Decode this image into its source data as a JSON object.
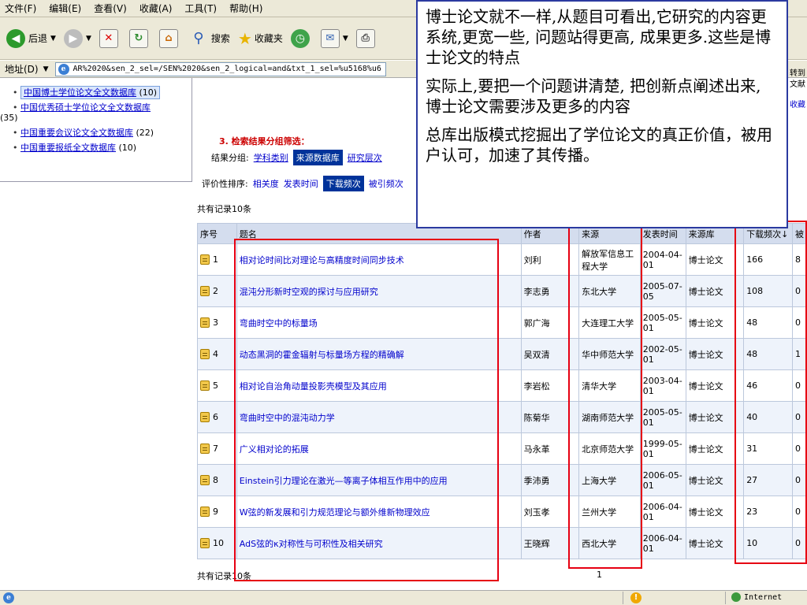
{
  "menu": [
    "文件(F)",
    "编辑(E)",
    "查看(V)",
    "收藏(A)",
    "工具(T)",
    "帮助(H)"
  ],
  "toolbar": {
    "back": "后退",
    "search": "搜索",
    "favorites": "收藏夹"
  },
  "address": {
    "label": "地址(D)",
    "url": "AR%2020&sen_2_sel=/SEN%2020&sen_2_logical=and&txt_1_sel=%u5168%u6"
  },
  "sidebar": {
    "items": [
      {
        "label": "中国博士学位论文全文数据库",
        "count": "(10)"
      },
      {
        "label": "中国优秀硕士学位论文全文数据库",
        "count": "(35)"
      },
      {
        "label": "中国重要会议论文全文数据库",
        "count": "(22)"
      },
      {
        "label": "中国重要报纸全文数据库",
        "count": "(10)"
      }
    ]
  },
  "filter": {
    "title": "3. 检索结果分组筛选：",
    "group_label": "结果分组:",
    "group_subject": "学科类别",
    "group_source": "来源数据库",
    "group_level": "研究层次",
    "sort_label": "评价性排序:",
    "sort_relevance": "相关度",
    "sort_date": "发表时间",
    "sort_downloads": "下载频次",
    "sort_cited": "被引频次"
  },
  "record_count": "共有记录10条",
  "page_number": "1",
  "table": {
    "headers": [
      "序号",
      "题名",
      "作者",
      "来源",
      "发表时间",
      "来源库",
      "下载频次↓",
      "被"
    ],
    "rows": [
      {
        "no": "1",
        "title": "相对论时间比对理论与高精度时间同步技术",
        "author": "刘利",
        "source": "解放军信息工程大学",
        "date": "2004-04-01",
        "db": "博士论文",
        "downloads": "166",
        "cited": "8"
      },
      {
        "no": "2",
        "title": "混沌分形新时空观的探讨与应用研究",
        "author": "李志勇",
        "source": "东北大学",
        "date": "2005-07-05",
        "db": "博士论文",
        "downloads": "108",
        "cited": "0"
      },
      {
        "no": "3",
        "title": "弯曲时空中的标量场",
        "author": "郭广海",
        "source": "大连理工大学",
        "date": "2005-05-01",
        "db": "博士论文",
        "downloads": "48",
        "cited": "0"
      },
      {
        "no": "4",
        "title": "动态黑洞的霍金辐射与标量场方程的精确解",
        "author": "吴双清",
        "source": "华中师范大学",
        "date": "2002-05-01",
        "db": "博士论文",
        "downloads": "48",
        "cited": "1"
      },
      {
        "no": "5",
        "title": "相对论自治角动量投影壳模型及其应用",
        "author": "李岩松",
        "source": "清华大学",
        "date": "2003-04-01",
        "db": "博士论文",
        "downloads": "46",
        "cited": "0"
      },
      {
        "no": "6",
        "title": "弯曲时空中的混沌动力学",
        "author": "陈菊华",
        "source": "湖南师范大学",
        "date": "2005-05-01",
        "db": "博士论文",
        "downloads": "40",
        "cited": "0"
      },
      {
        "no": "7",
        "title": "广义相对论的拓展",
        "author": "马永革",
        "source": "北京师范大学",
        "date": "1999-05-01",
        "db": "博士论文",
        "downloads": "31",
        "cited": "0"
      },
      {
        "no": "8",
        "title": "Einstein引力理论在激光—等离子体相互作用中的应用",
        "author": "季沛勇",
        "source": "上海大学",
        "date": "2006-05-01",
        "db": "博士论文",
        "downloads": "27",
        "cited": "0"
      },
      {
        "no": "9",
        "title": "W弦的新发展和引力规范理论与额外维新物理效应",
        "author": "刘玉孝",
        "source": "兰州大学",
        "date": "2006-04-01",
        "db": "博士论文",
        "downloads": "23",
        "cited": "0"
      },
      {
        "no": "10",
        "title": "AdS弦的κ对称性与可积性及相关研究",
        "author": "王晓辉",
        "source": "西北大学",
        "date": "2006-04-01",
        "db": "博士论文",
        "downloads": "10",
        "cited": "0"
      }
    ]
  },
  "right_edge": {
    "line1": "转到",
    "line2": "文献",
    "line3": "收藏"
  },
  "status": {
    "zone": "Internet"
  },
  "callout": {
    "p1": "博士论文就不一样,从题目可看出,它研究的内容更系统,更宽一些, 问题站得更高, 成果更多.这些是博士论文的特点",
    "p2": "实际上,要把一个问题讲清楚, 把创新点阐述出来, 博士论文需要涉及更多的内容",
    "p3": "总库出版模式挖掘出了学位论文的真正价值，被用户认可，加速了其传播。"
  },
  "colors": {
    "highlight_box": "#e60012",
    "callout_border": "#2b3aa0",
    "selected_tab": "#00339a",
    "link": "#0000cc"
  }
}
